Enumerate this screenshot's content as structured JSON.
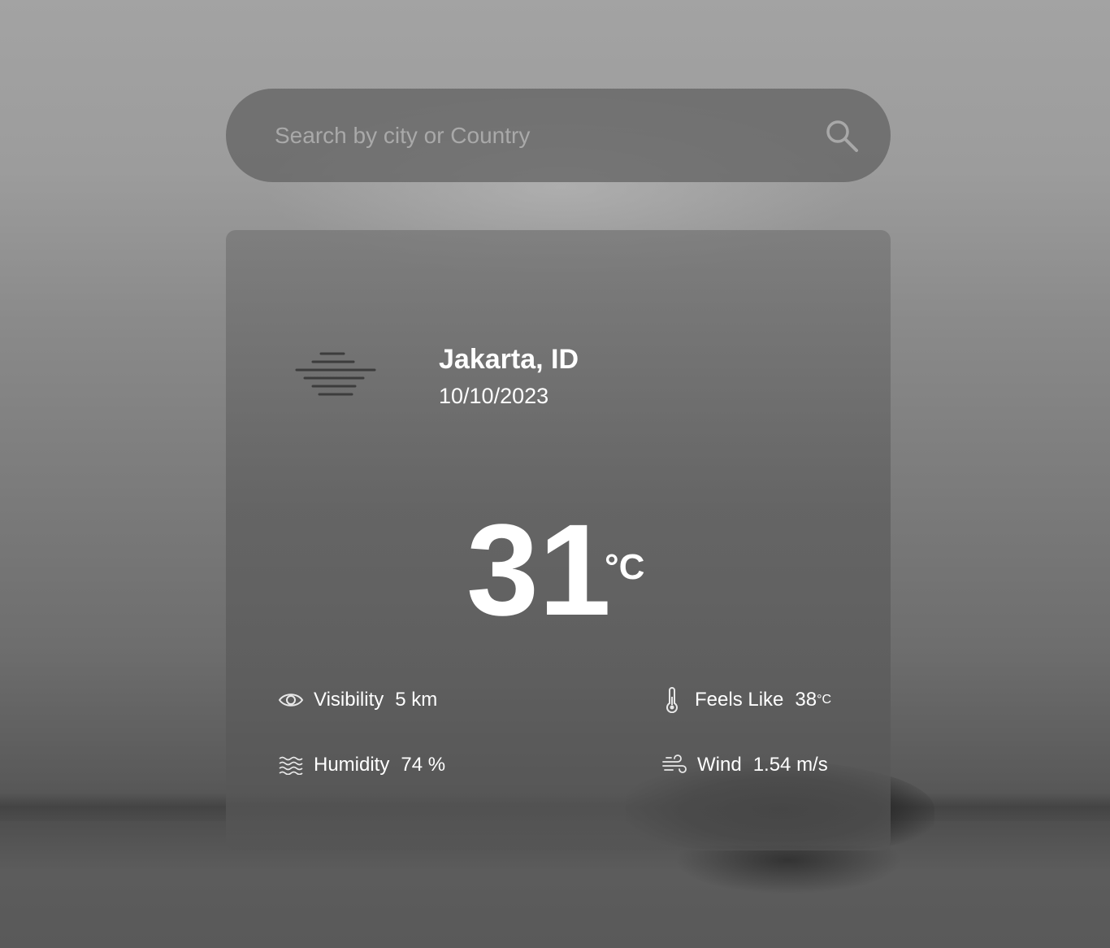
{
  "search": {
    "placeholder": "Search by city or Country",
    "icon": "search-icon"
  },
  "weather": {
    "condition_icon": "haze-icon",
    "location": "Jakarta, ID",
    "date": "10/10/2023",
    "temperature": "31",
    "temperature_unit": "°C"
  },
  "details": {
    "visibility": {
      "icon": "eye-icon",
      "label": "Visibility",
      "value": "5 km"
    },
    "humidity": {
      "icon": "humidity-waves-icon",
      "label": "Humidity",
      "value": "74 %"
    },
    "feels_like": {
      "icon": "thermometer-icon",
      "label": "Feels Like",
      "value": "38",
      "unit": "°C"
    },
    "wind": {
      "icon": "wind-icon",
      "label": "Wind",
      "value": "1.54 m/s"
    }
  },
  "colors": {
    "text": "#ffffff",
    "placeholder": "#a9a9a9",
    "panel": "#5f5f5f"
  }
}
